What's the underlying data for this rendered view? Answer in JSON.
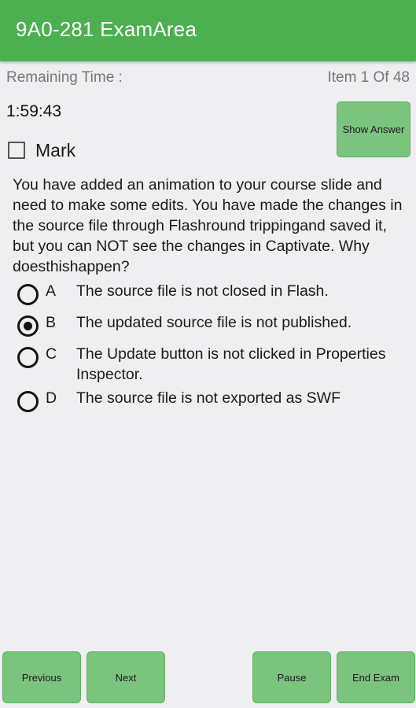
{
  "app_bar": {
    "title": "9A0-281 ExamArea",
    "background_color": "#4caf50",
    "title_color": "#ffffff"
  },
  "status": {
    "remaining_time_label": "Remaining Time :",
    "item_counter": "Item 1 Of 48",
    "current_item": 1,
    "total_items": 48,
    "timer_value": "1:59:43"
  },
  "mark": {
    "label": "Mark",
    "checked": false
  },
  "show_answer": {
    "label": "Show Answer"
  },
  "question": {
    "text": "You have added an animation to your course slide and need to make some edits. You have made the changes in the source file through Flashround trippingand saved it, but you can NOT see the changes in Captivate. Why doesthishappen?"
  },
  "options": [
    {
      "letter": "A",
      "text": "The source file is not closed in Flash.",
      "selected": false
    },
    {
      "letter": "B",
      "text": "The updated source file is not published.",
      "selected": true
    },
    {
      "letter": "C",
      "text": "The Update button is not clicked in Properties Inspector.",
      "selected": false
    },
    {
      "letter": "D",
      "text": "The source file is not exported as SWF",
      "selected": false
    }
  ],
  "bottom_bar": {
    "previous_label": "Previous",
    "next_label": "Next",
    "pause_label": "Pause",
    "end_exam_label": "End Exam",
    "button_color": "#7ac47e"
  }
}
